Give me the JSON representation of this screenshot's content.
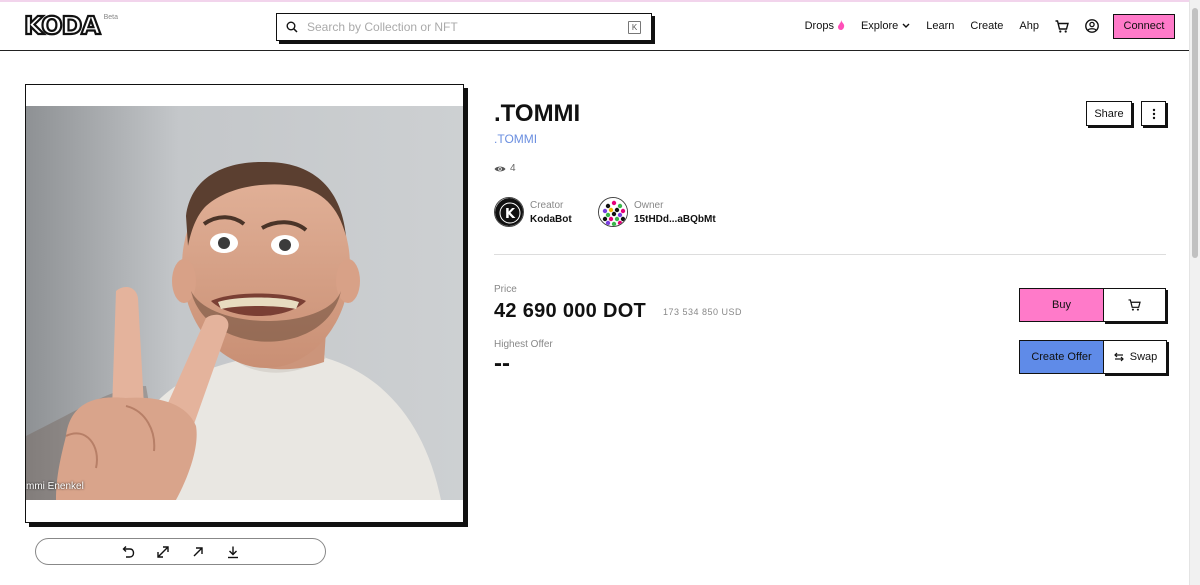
{
  "header": {
    "logo": "KODA",
    "beta": "Beta",
    "search_placeholder": "Search by Collection or NFT",
    "search_shortcut": "K",
    "nav": {
      "drops": "Drops",
      "explore": "Explore",
      "learn": "Learn",
      "create": "Create",
      "chain": "Ahp",
      "connect": "Connect"
    }
  },
  "media": {
    "caption": "mmi Enenkel",
    "controls": [
      "undo-icon",
      "expand-icon",
      "open-external-icon",
      "download-icon"
    ]
  },
  "nft": {
    "title": ".TOMMI",
    "collection": ".TOMMI",
    "views": "4",
    "share": "Share",
    "creator": {
      "role": "Creator",
      "name": "KodaBot"
    },
    "owner": {
      "role": "Owner",
      "name": "15tHDd...aBQbMt"
    }
  },
  "price": {
    "label": "Price",
    "amount": "42 690 000 DOT",
    "usd": "173 534 850 USD",
    "highest_offer_label": "Highest Offer",
    "highest_offer_value": "--"
  },
  "actions": {
    "buy": "Buy",
    "create_offer": "Create Offer",
    "swap": "Swap"
  },
  "colors": {
    "accent_pink": "#ff7ac9",
    "accent_blue": "#5f8be8",
    "link_blue": "#6b8fe0"
  }
}
